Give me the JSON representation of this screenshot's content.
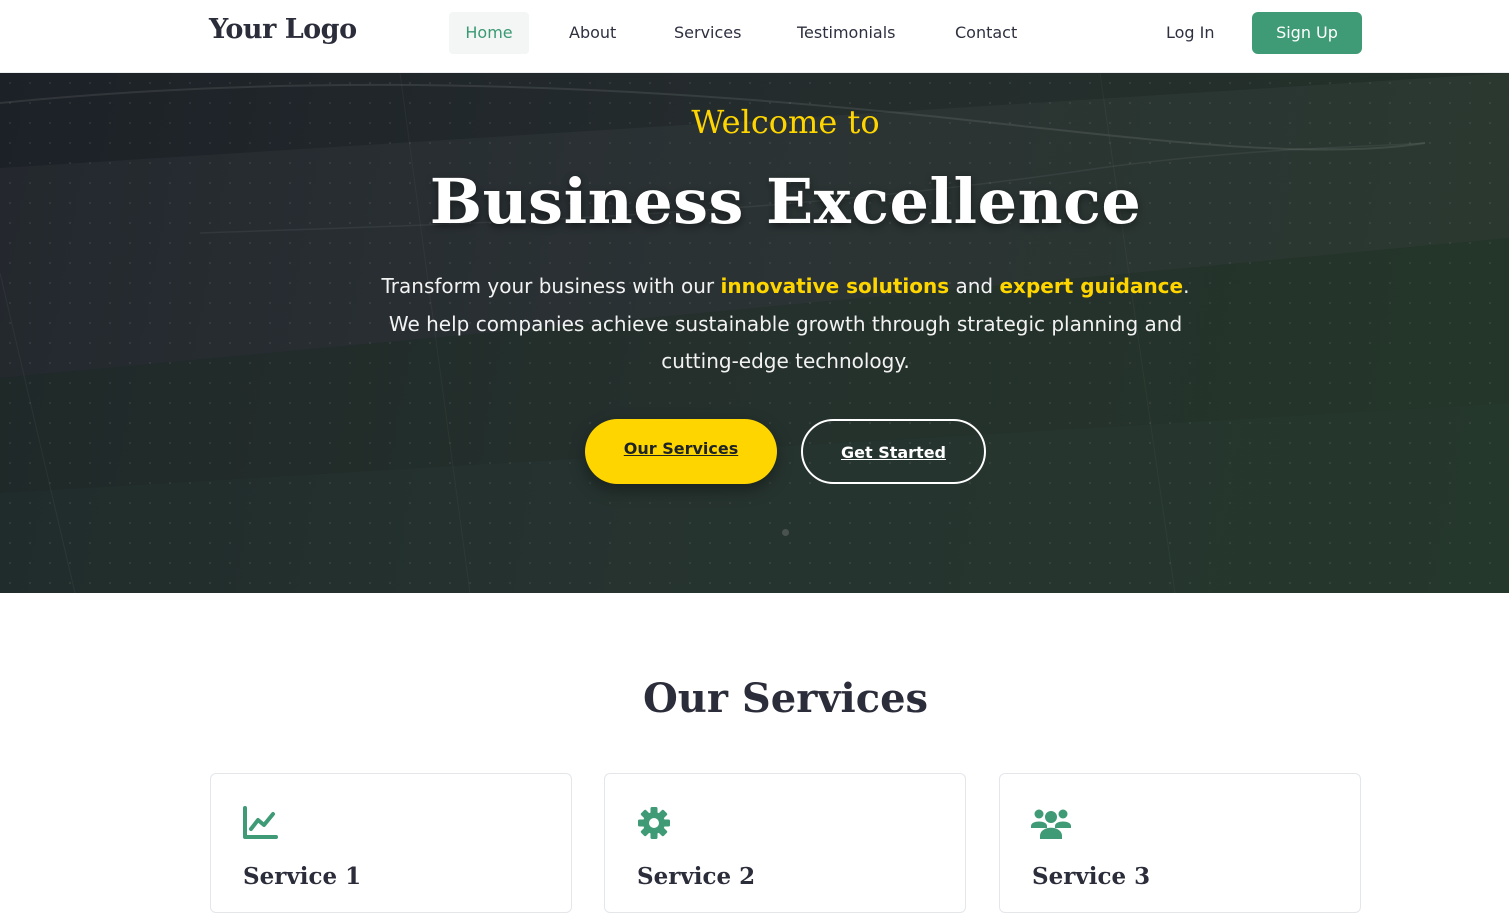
{
  "nav": {
    "logo": "Your Logo",
    "links": [
      "Home",
      "About",
      "Services",
      "Testimonials",
      "Contact"
    ],
    "active": "Home",
    "login": "Log In",
    "signup": "Sign Up"
  },
  "hero": {
    "kicker": "Welcome to",
    "title": "Business Excellence",
    "text": {
      "part1": "Transform your business with our ",
      "highlight1": "innovative solutions",
      "part2": " and ",
      "highlight2": "expert guidance",
      "part3": ". We help companies achieve sustainable growth through strategic planning and cutting-edge technology."
    },
    "primary_button": "Our Services",
    "secondary_button": "Get Started"
  },
  "services": {
    "title": "Our Services",
    "cards": [
      {
        "icon": "chart-line-icon",
        "title": "Service 1"
      },
      {
        "icon": "gear-icon",
        "title": "Service 2"
      },
      {
        "icon": "users-icon",
        "title": "Service 3"
      }
    ]
  },
  "colors": {
    "accent_green": "#3f9a76",
    "accent_yellow": "#ffd500",
    "hero_dark": "#1f262a",
    "text_dark": "#2b2d3a"
  }
}
